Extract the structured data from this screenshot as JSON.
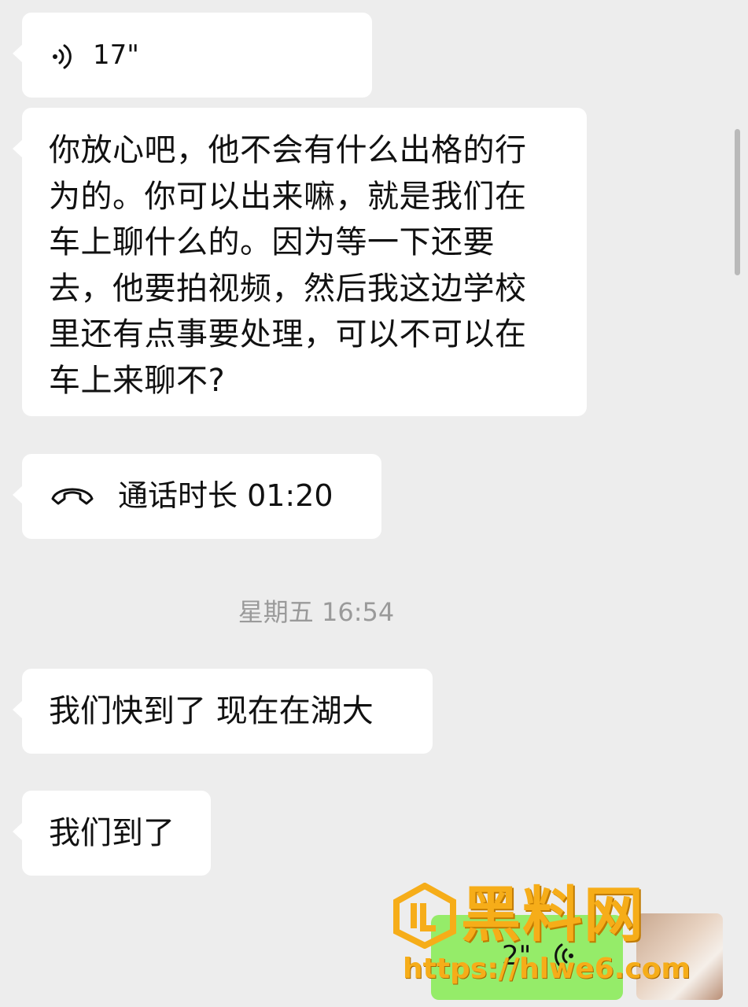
{
  "messages": {
    "voice_in": {
      "duration": "17\"",
      "icon": "voice-wave-icon"
    },
    "long_text": {
      "lines": [
        "你放心吧，他不会有什么出格的行",
        "为的。你可以出来嘛，就是我们在",
        "车上聊什么的。因为等一下还要",
        "去，他要拍视频，然后我这边学校",
        "里还有点事要处理，可以不可以在",
        "车上来聊不?"
      ]
    },
    "call": {
      "label": "通话时长 01:20",
      "icon": "phone-hangup-icon"
    },
    "timestamp": "星期五 16:54",
    "msg1": "我们快到了 现在在湖大",
    "msg2": "我们到了",
    "voice_out": {
      "duration": "2\"",
      "icon": "voice-wave-icon"
    }
  },
  "watermark": {
    "title": "黑料网",
    "url": "https://hlwe6.com"
  },
  "colors": {
    "background": "#ededed",
    "bubble_in": "#ffffff",
    "bubble_out": "#95ec69",
    "timestamp": "#9a9a9a",
    "watermark": "#f6ad19"
  }
}
